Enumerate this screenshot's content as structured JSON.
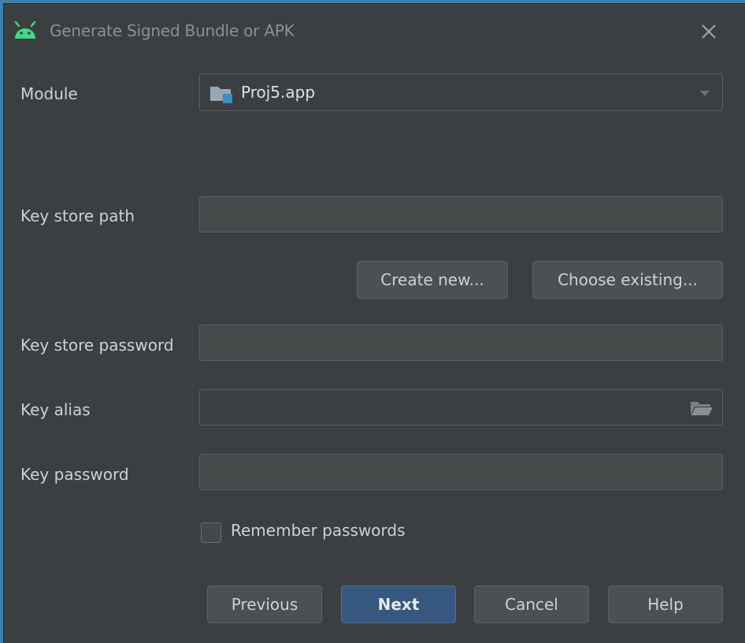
{
  "dialog": {
    "title": "Generate Signed Bundle or APK",
    "icon": "android-icon",
    "close_icon": "close-icon"
  },
  "module": {
    "label": "Module",
    "selected": "Proj5.app",
    "icon": "module-folder-icon"
  },
  "key_store_path": {
    "label": "Key store path",
    "value": ""
  },
  "key_store_buttons": {
    "create_new": "Create new...",
    "choose_existing": "Choose existing..."
  },
  "key_store_password": {
    "label": "Key store password",
    "value": ""
  },
  "key_alias": {
    "label": "Key alias",
    "value": "",
    "icon": "folder-open-icon"
  },
  "key_password": {
    "label": "Key password",
    "value": ""
  },
  "remember_passwords": {
    "label": "Remember passwords",
    "checked": false
  },
  "footer": {
    "previous": "Previous",
    "next": "Next",
    "cancel": "Cancel",
    "help": "Help"
  },
  "colors": {
    "background": "#3c3f41",
    "field": "#45494a",
    "primary_button": "#365880",
    "android_green": "#3ddc84",
    "module_badge": "#3592c4"
  }
}
